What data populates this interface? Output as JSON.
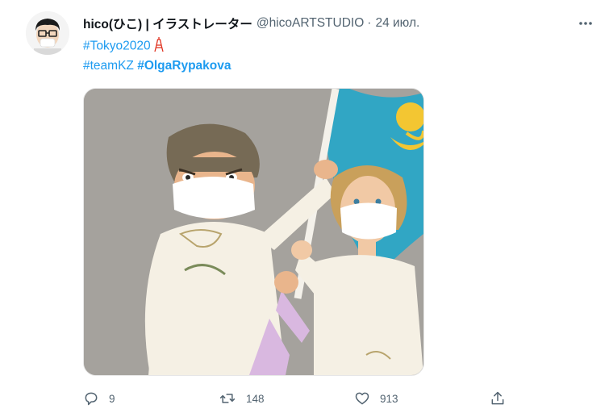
{
  "tweet": {
    "author_name": "hico(ひこ) | イラストレーター",
    "handle": "@hicoARTSTUDIO",
    "separator": "·",
    "date": "24 июл.",
    "hashtag1": "#Tokyo2020",
    "hashtag2": "#teamKZ",
    "hashtag3": "#OlgaRypakova",
    "emoji": "tokyo-tower-icon"
  },
  "stats": {
    "replies": "9",
    "retweets": "148",
    "likes": "913"
  },
  "icons": {
    "avatar": "cartoon-glasses-avatar",
    "more": "more-horizontal-icon",
    "reply": "reply-icon",
    "retweet": "retweet-icon",
    "like": "heart-icon",
    "share": "share-icon"
  },
  "colors": {
    "link": "#1d9bf0",
    "text": "#0f1419",
    "secondary": "#536471",
    "flag": "#31a6c4",
    "emblem": "#f3c632"
  }
}
